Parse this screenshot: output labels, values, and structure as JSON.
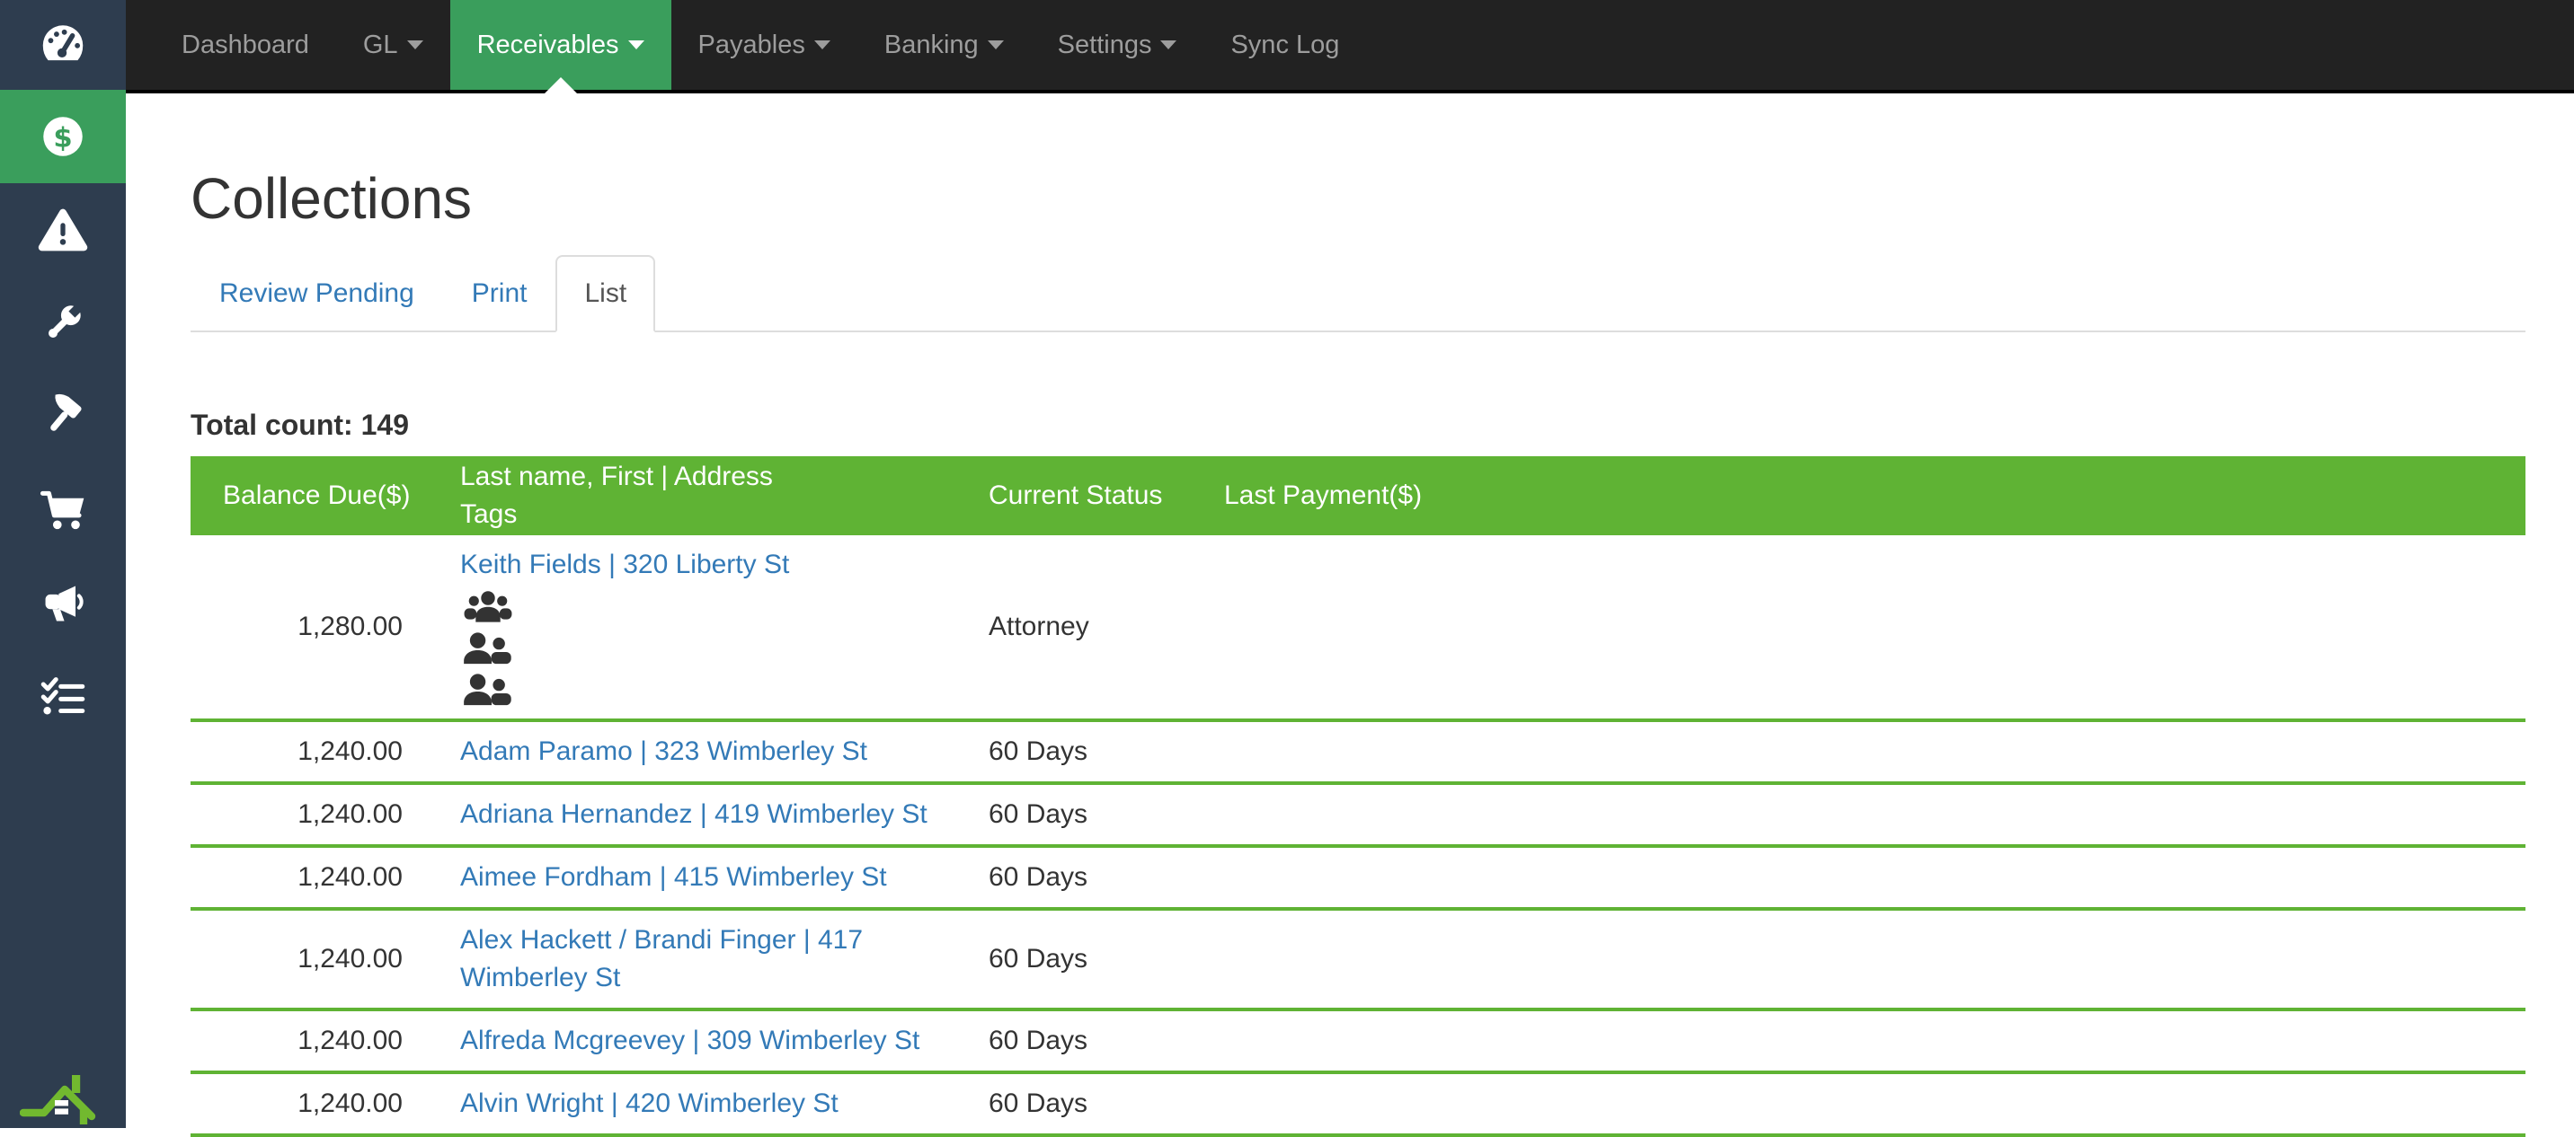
{
  "nav": {
    "items": [
      {
        "label": "Dashboard",
        "caret": false,
        "active": false
      },
      {
        "label": "GL",
        "caret": true,
        "active": false
      },
      {
        "label": "Receivables",
        "caret": true,
        "active": true
      },
      {
        "label": "Payables",
        "caret": true,
        "active": false
      },
      {
        "label": "Banking",
        "caret": true,
        "active": false
      },
      {
        "label": "Settings",
        "caret": true,
        "active": false
      },
      {
        "label": "Sync Log",
        "caret": false,
        "active": false
      }
    ]
  },
  "sidebar": {
    "items": [
      {
        "icon": "dollar-circle-icon",
        "active": true
      },
      {
        "icon": "warning-triangle-icon",
        "active": false
      },
      {
        "icon": "wrench-icon",
        "active": false
      },
      {
        "icon": "hammer-icon",
        "active": false
      },
      {
        "icon": "shopping-cart-icon",
        "active": false
      },
      {
        "icon": "megaphone-icon",
        "active": false
      },
      {
        "icon": "checklist-icon",
        "active": false
      }
    ],
    "brand_icon": "gauge-logo-icon",
    "bottom_logo": "roofline-logo"
  },
  "page": {
    "title": "Collections",
    "tabs": [
      {
        "label": "Review Pending",
        "active": false
      },
      {
        "label": "Print",
        "active": false
      },
      {
        "label": "List",
        "active": true
      }
    ],
    "total_count_label": "Total count: 149"
  },
  "table": {
    "columns": [
      {
        "id": "balance",
        "label": "Balance Due($)"
      },
      {
        "id": "name",
        "label": "Last name, First | Address",
        "label2": "Tags"
      },
      {
        "id": "status",
        "label": "Current Status"
      },
      {
        "id": "payment",
        "label": "Last Payment($)"
      }
    ],
    "rows": [
      {
        "balance": "1,280.00",
        "name": "Keith Fields | 320 Liberty St",
        "status": "Attorney",
        "last_payment": "",
        "tags": [
          "group-users-icon",
          "two-users-icon",
          "two-users-icon"
        ]
      },
      {
        "balance": "1,240.00",
        "name": "Adam Paramo | 323 Wimberley St",
        "status": "60 Days",
        "last_payment": ""
      },
      {
        "balance": "1,240.00",
        "name": "Adriana Hernandez | 419 Wimberley St",
        "status": "60 Days",
        "last_payment": ""
      },
      {
        "balance": "1,240.00",
        "name": "Aimee Fordham | 415 Wimberley St",
        "status": "60 Days",
        "last_payment": ""
      },
      {
        "balance": "1,240.00",
        "name": "Alex Hackett / Brandi Finger | 417 Wimberley St",
        "status": "60 Days",
        "last_payment": ""
      },
      {
        "balance": "1,240.00",
        "name": "Alfreda Mcgreevey | 309 Wimberley St",
        "status": "60 Days",
        "last_payment": ""
      },
      {
        "balance": "1,240.00",
        "name": "Alvin Wright | 420 Wimberley St",
        "status": "60 Days",
        "last_payment": ""
      }
    ]
  },
  "colors": {
    "sidebar_bg": "#2e3d4f",
    "navbar_bg": "#222222",
    "nav_active_green": "#3a9e5c",
    "table_header_green": "#5fb334",
    "row_border_green": "#5fb334",
    "link_blue": "#337ab7",
    "logo_green": "#72b92f",
    "text_dark": "#333333",
    "nav_text_gray": "#9d9d9d"
  }
}
